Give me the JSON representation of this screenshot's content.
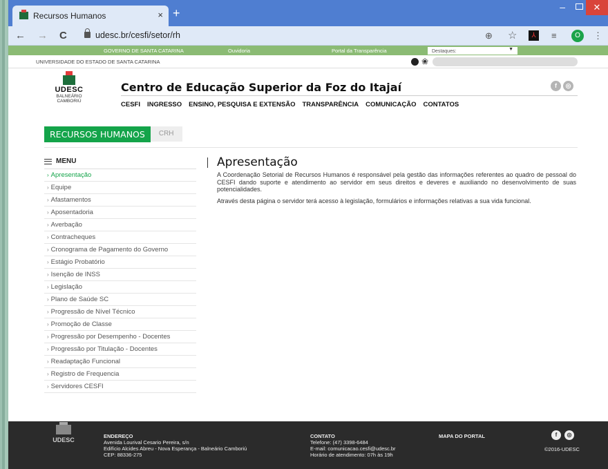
{
  "browser": {
    "tab_title": "Recursos Humanos",
    "tab_close": "×",
    "new_tab": "+",
    "url": "udesc.br/cesfi/setor/rh",
    "profile_initial": "O",
    "back": "←",
    "forward": "→",
    "reload": "C",
    "zoom": "⊕",
    "star": "☆",
    "extensions": "≡",
    "more": "⋮",
    "minimize": "–",
    "close": "✕"
  },
  "govbar": {
    "governo": "GOVERNO DE SANTA CATARINA",
    "ouvidoria": "Ouvidoria",
    "transparencia": "Portal da Transparência",
    "destaques": "Destaques:",
    "dest_arrow": "▼"
  },
  "unibar": {
    "name": "UNIVERSIDADE DO ESTADO DE SANTA CATARINA",
    "vlibras": "❀"
  },
  "header": {
    "logo_text": "UDESC",
    "campus_line1": "BALNEÁRIO",
    "campus_line2": "CAMBORIÚ",
    "title": "Centro de Educação Superior da Foz do Itajaí",
    "facebook": "f",
    "instagram": "◎",
    "nav": [
      "CESFI",
      "INGRESSO",
      "ENSINO, PESQUISA E EXTENSÃO",
      "TRANSPARÊNCIA",
      "COMUNICAÇÃO",
      "CONTATOS"
    ]
  },
  "section": {
    "title": "RECURSOS HUMANOS",
    "tag": "CRH"
  },
  "menu": {
    "heading": "MENU",
    "chevron": "›",
    "items": [
      "Apresentação",
      "Equipe",
      "Afastamentos",
      "Aposentadoria",
      "Averbação",
      "Contracheques",
      "Cronograma de Pagamento do Governo",
      "Estágio Probatório",
      "Isenção de INSS",
      "Legislação",
      "Plano de Saúde SC",
      "Progressão de Nível Técnico",
      "Promoção de Classe",
      "Progressão por Desempenho - Docentes",
      "Progressão por Titulação - Docentes",
      "Readaptação Funcional",
      "Registro de Frequencia",
      "Servidores CESFI"
    ]
  },
  "content": {
    "title": "Apresentação",
    "p1": "A Coordenação Setorial de Recursos Humanos é responsável pela gestão das informações referentes ao quadro de pessoal do CESFI dando suporte e atendimento ao servidor em seus direitos e deveres e auxiliando no desenvolvimento de suas potencialidades.",
    "p2": "Através desta página o servidor terá acesso à legislação, formulários e informações relativas a sua vida funcional."
  },
  "footer": {
    "logo_text": "UDESC",
    "endereco_label": "ENDEREÇO",
    "endereco_1": "Avenida Lourival Cesario Pereira, s/n",
    "endereco_2": "Edifício Alcides Abreu - Nova Esperança - Balneário Camboriú",
    "endereco_3": "CEP: 88336-275",
    "contato_label": "CONTATO",
    "contato_1": "Telefone: (47) 3398-6484",
    "contato_2": "E-mail: comunicacao.cesfi@udesc.br",
    "contato_3": "Horário de atendimento: 07h às 19h",
    "mapa": "MAPA DO PORTAL",
    "facebook": "f",
    "instagram": "◎",
    "copyright": "©2016-UDESC"
  }
}
